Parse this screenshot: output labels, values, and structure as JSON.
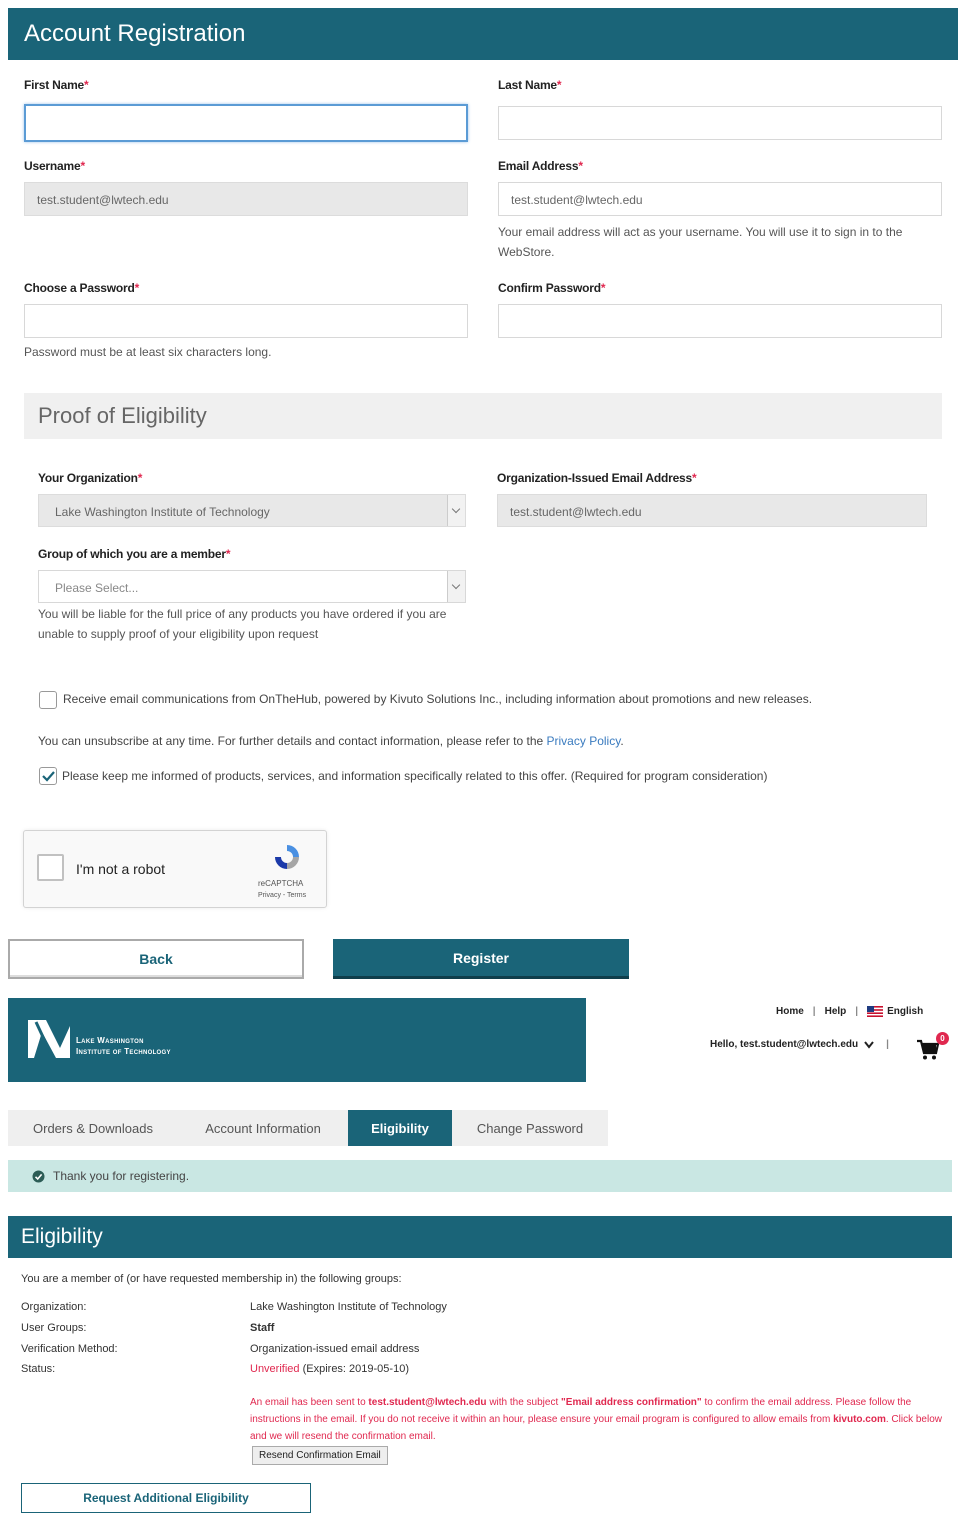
{
  "registration": {
    "title": "Account Registration",
    "first_name_label": "First Name",
    "last_name_label": "Last Name",
    "username_label": "Username",
    "username_value": "test.student@lwtech.edu",
    "email_label": "Email Address",
    "email_value": "test.student@lwtech.edu",
    "email_hint": "Your email address will act as your username. You will use it to sign in to the WebStore.",
    "password_label": "Choose a Password",
    "confirm_password_label": "Confirm Password",
    "password_hint": "Password must be at least six characters long.",
    "required_mark": "*"
  },
  "eligibility_form": {
    "title": "Proof of Eligibility",
    "org_label": "Your Organization",
    "org_value": "Lake Washington Institute of Technology",
    "org_email_label": "Organization-Issued Email Address",
    "org_email_value": "test.student@lwtech.edu",
    "group_label": "Group of which you are a member",
    "group_placeholder": "Please Select...",
    "liability_hint": "You will be liable for the full price of any products you have ordered if you are unable to supply proof of your eligibility upon request"
  },
  "consent": {
    "email_comm_text": "Receive email communications from OnTheHub, powered by Kivuto Solutions Inc., including information about promotions and new releases.",
    "unsubscribe_text": "You can unsubscribe at any time. For further details and contact information, please refer to the",
    "privacy_link": "Privacy Policy",
    "privacy_period": ".",
    "keep_informed_text": "Please keep me informed of products, services, and information specifically related to this offer. (Required for program consideration)"
  },
  "recaptcha": {
    "label": "I'm not a robot",
    "brand": "reCAPTCHA",
    "links": "Privacy - Terms"
  },
  "buttons": {
    "back": "Back",
    "register": "Register"
  },
  "header": {
    "logo_line1": "Lake Washington",
    "logo_line2": "Institute of Technology",
    "nav_home": "Home",
    "nav_help": "Help",
    "nav_language": "English",
    "nav_sep": "|",
    "greeting": "Hello, test.student@lwtech.edu",
    "cart_count": "0"
  },
  "tabs": [
    "Orders & Downloads",
    "Account Information",
    "Eligibility",
    "Change Password"
  ],
  "alert": {
    "message": "Thank you for registering."
  },
  "eligibility": {
    "title": "Eligibility",
    "intro": "You are a member of (or have requested membership in) the following groups:",
    "org_label": "Organization:",
    "org_value": "Lake Washington Institute of Technology",
    "groups_label": "User Groups:",
    "groups_value": "Staff",
    "method_label": "Verification Method:",
    "method_value": "Organization-issued email address",
    "status_label": "Status:",
    "status_value": "Unverified",
    "status_expires": "(Expires: 2019-05-10)",
    "notice_1": "An email has been sent to",
    "notice_email": "test.student@lwtech.edu",
    "notice_2": "with the subject",
    "notice_subject": "\"Email address confirmation\"",
    "notice_3": "to confirm the email address. Please follow the instructions in the email. If you do not receive it within an hour, please ensure your email program is configured to allow emails from",
    "notice_domain": "kivuto.com",
    "notice_4": ". Click below and we will resend the confirmation email.",
    "resend_button": "Resend Confirmation Email",
    "request_button": "Request Additional Eligibility"
  },
  "colors": {
    "primary": "#1a6478",
    "required": "#e0284f",
    "alert_bg": "#c9e7e3",
    "link": "#3a7bbf"
  }
}
